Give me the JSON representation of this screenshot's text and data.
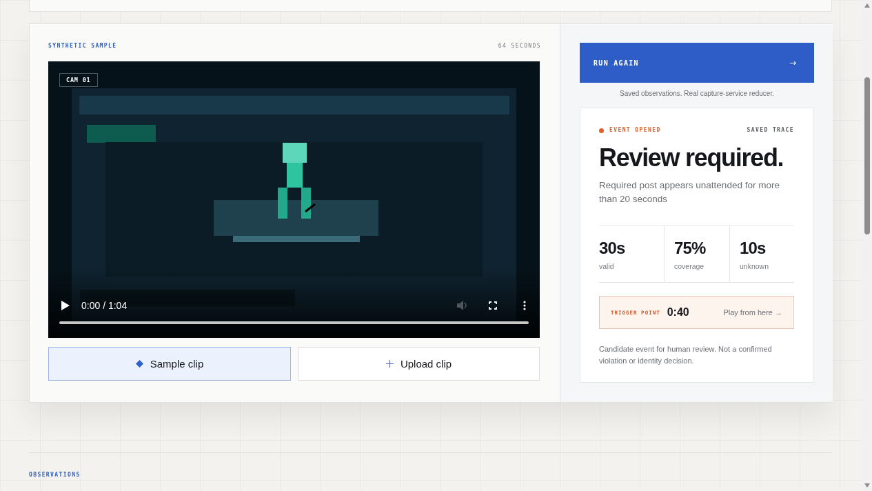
{
  "sample": {
    "label": "SYNTHETIC SAMPLE",
    "duration": "64 SECONDS",
    "video": {
      "camera_badge": "CAM 01",
      "time": "0:00 / 1:04",
      "progress": {
        "level": 0
      },
      "volume": {
        "disabled": true
      }
    },
    "buttons": [
      {
        "kind": "sample",
        "label": "Sample clip",
        "selected": true
      },
      {
        "kind": "upload",
        "label": "Upload clip",
        "selected": false
      }
    ]
  },
  "panel": {
    "run_button": {
      "label": "RUN AGAIN",
      "arrow": "→"
    },
    "caption": "Saved observations. Real capture-service reducer.",
    "event": {
      "status": "EVENT OPENED",
      "source": "SAVED TRACE",
      "title": "Review required.",
      "description": "Required post appears unattended for more than 20 seconds",
      "stats": [
        {
          "value": "30s",
          "label": "valid"
        },
        {
          "value": "75%",
          "label": "coverage"
        },
        {
          "value": "10s",
          "label": "unknown"
        }
      ],
      "trigger": {
        "label": "TRIGGER POINT",
        "time": "0:40",
        "action": "Play from here →"
      },
      "note": "Candidate event for human review. Not a confirmed violation or identity decision."
    }
  },
  "observations": {
    "label": "OBSERVATIONS"
  }
}
